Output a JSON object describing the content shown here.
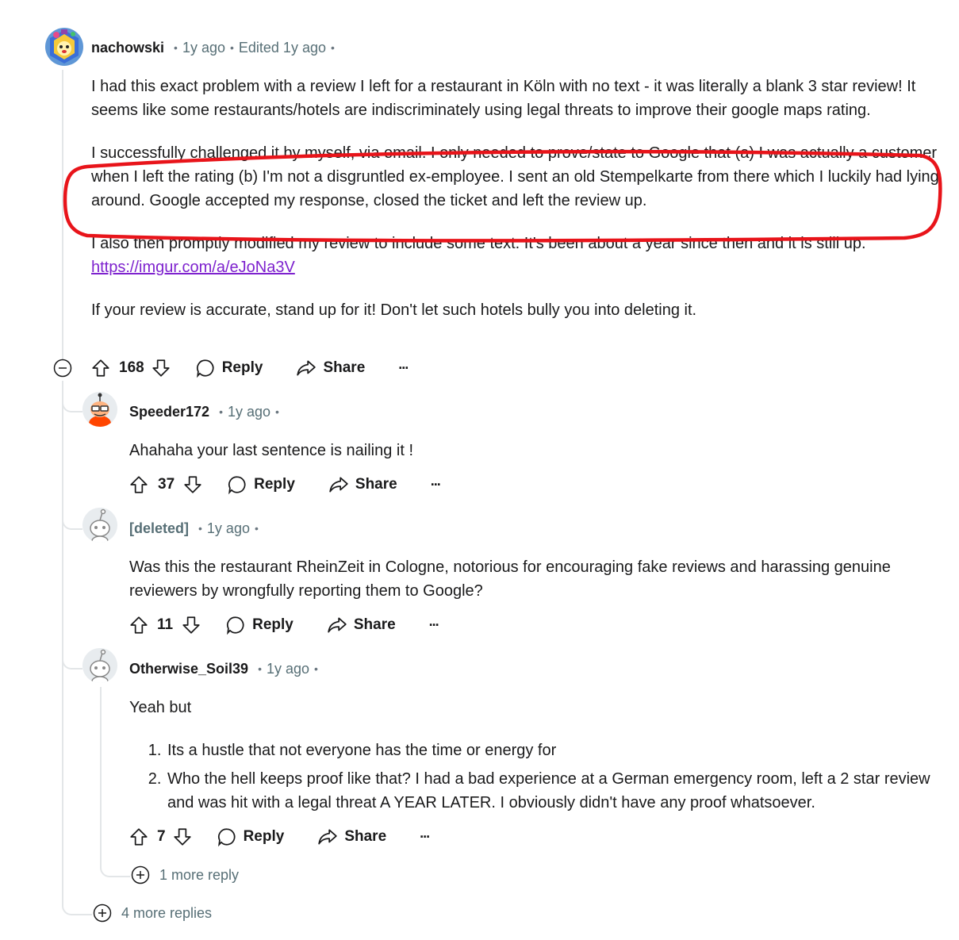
{
  "comment": {
    "author": "nachowski",
    "time": "1y ago",
    "edited": "Edited 1y ago",
    "paragraphs": [
      "I had this exact problem with a review I left for a restaurant in Köln with no text - it was literally a blank 3 star review! It seems like some restaurants/hotels are indiscriminately using legal threats to improve their google maps rating.",
      "I successfully challenged it by myself, via email. I only needed to prove/state to Google that (a) I was actually a customer when I left the rating (b) I'm not a disgruntled ex-employee. I sent an old Stempelkarte from there which I luckily had lying around. Google accepted my response, closed the ticket and left the review up.",
      "I also then promptly modified my review to include some text. It's been about a year since then and it is still up.",
      "If your review is accurate, stand up for it! Don't let such hotels bully you into deleting it."
    ],
    "link": "https://imgur.com/a/eJoNa3V",
    "votes": "168",
    "reply_label": "Reply",
    "share_label": "Share",
    "more_label": "···"
  },
  "replies": [
    {
      "author": "Speeder172",
      "time": "1y ago",
      "text": "Ahahaha your last sentence is nailing it !",
      "votes": "37"
    },
    {
      "author": "[deleted]",
      "time": "1y ago",
      "text": "Was this the restaurant RheinZeit in Cologne, notorious for encouraging fake reviews and harassing genuine reviewers by wrongfully reporting them to Google?",
      "votes": "11"
    },
    {
      "author": "Otherwise_Soil39",
      "time": "1y ago",
      "text": "Yeah but",
      "list": [
        "Its a hustle that not everyone has the time or energy for",
        "Who the hell keeps proof like that? I had a bad experience at a German emergency room, left a 2 star review and was hit with a legal threat A YEAR LATER. I obviously didn't have any proof whatsoever."
      ],
      "votes": "7"
    }
  ],
  "more_reply": "1 more reply",
  "more_replies": "4 more replies",
  "colors": {
    "highlight": "#e8141a",
    "link": "#7e22ce",
    "muted": "#576f76",
    "thread": "#e3e6e8"
  }
}
